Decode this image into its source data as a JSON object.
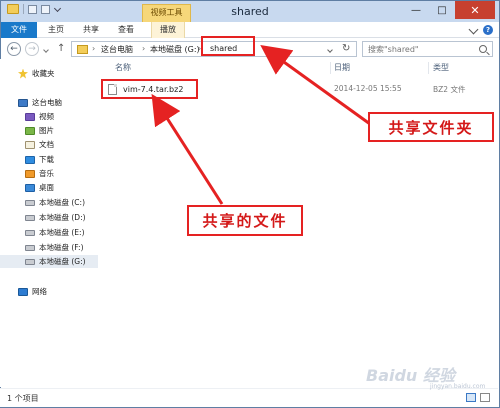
{
  "window": {
    "title": "shared",
    "context_tab": "视频工具"
  },
  "ribbon": {
    "tabs": [
      "文件",
      "主页",
      "共享",
      "查看",
      "播放"
    ]
  },
  "address": {
    "crumbs": [
      "这台电脑",
      "本地磁盘 (G:)",
      "shared"
    ],
    "search_placeholder": "搜索\"shared\""
  },
  "nav_pane": {
    "items": [
      {
        "label": "收藏夹",
        "icon": "star-icon"
      },
      {
        "label": "这台电脑",
        "icon": "computer-icon"
      },
      {
        "label": "视频",
        "icon": "video-folder-icon"
      },
      {
        "label": "图片",
        "icon": "pictures-folder-icon"
      },
      {
        "label": "文档",
        "icon": "documents-folder-icon"
      },
      {
        "label": "下载",
        "icon": "downloads-folder-icon"
      },
      {
        "label": "音乐",
        "icon": "music-folder-icon"
      },
      {
        "label": "桌面",
        "icon": "desktop-folder-icon"
      },
      {
        "label": "本地磁盘 (C:)",
        "icon": "drive-icon"
      },
      {
        "label": "本地磁盘 (D:)",
        "icon": "drive-icon"
      },
      {
        "label": "本地磁盘 (E:)",
        "icon": "drive-icon"
      },
      {
        "label": "本地磁盘 (F:)",
        "icon": "drive-icon"
      },
      {
        "label": "本地磁盘 (G:)",
        "icon": "drive-icon"
      },
      {
        "label": "网络",
        "icon": "network-icon"
      }
    ]
  },
  "columns": {
    "name": "名称",
    "date": "日期",
    "type": "类型"
  },
  "files": [
    {
      "name": "vim-7.4.tar.bz2",
      "date": "2014-12-05 15:55",
      "type": "BZ2 文件"
    }
  ],
  "annotations": {
    "folder_label": "共享文件夹",
    "file_label": "共享的文件"
  },
  "status": {
    "count": "1 个项目"
  },
  "watermark": {
    "main": "Baidu 经验",
    "sub": "jingyan.baidu.com"
  },
  "colors": {
    "accent_blue": "#1979ca",
    "annotation_red": "#e52222",
    "close_red": "#c7402f"
  }
}
